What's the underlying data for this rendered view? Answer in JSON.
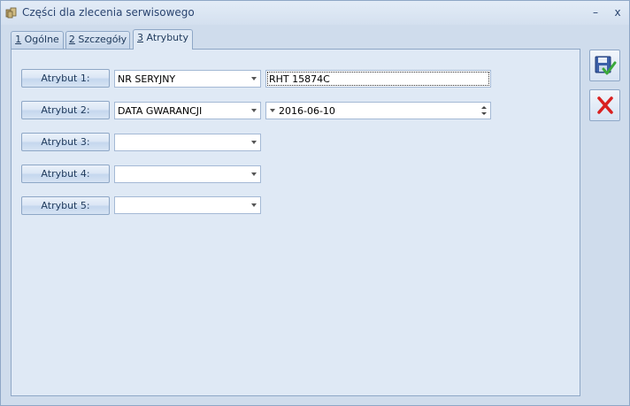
{
  "window": {
    "title": "Części dla zlecenia serwisowego",
    "minimize_glyph": "–",
    "close_glyph": "x"
  },
  "tabs": [
    {
      "key": "1",
      "label": " Ogólne",
      "active": false
    },
    {
      "key": "2",
      "label": " Szczegóły",
      "active": false
    },
    {
      "key": "3",
      "label": " Atrybuty",
      "active": true
    }
  ],
  "attributes": [
    {
      "button": "Atrybut 1:",
      "name": "NR SERYJNY",
      "value": "RHT 15874C",
      "value_type": "text"
    },
    {
      "button": "Atrybut 2:",
      "name": "DATA GWARANCJI",
      "value": "2016-06-10",
      "value_type": "date"
    },
    {
      "button": "Atrybut 3:",
      "name": "",
      "value": ""
    },
    {
      "button": "Atrybut 4:",
      "name": "",
      "value": ""
    },
    {
      "button": "Atrybut 5:",
      "name": "",
      "value": ""
    }
  ],
  "side_buttons": {
    "save_icon": "save-check-icon",
    "cancel_icon": "red-x-icon"
  },
  "colors": {
    "window_bg": "#cfdcec",
    "panel_bg": "#dfe9f5",
    "border": "#8ea7c6",
    "text": "#1e395b",
    "cancel_red": "#d92020",
    "save_green": "#3aa83a"
  }
}
